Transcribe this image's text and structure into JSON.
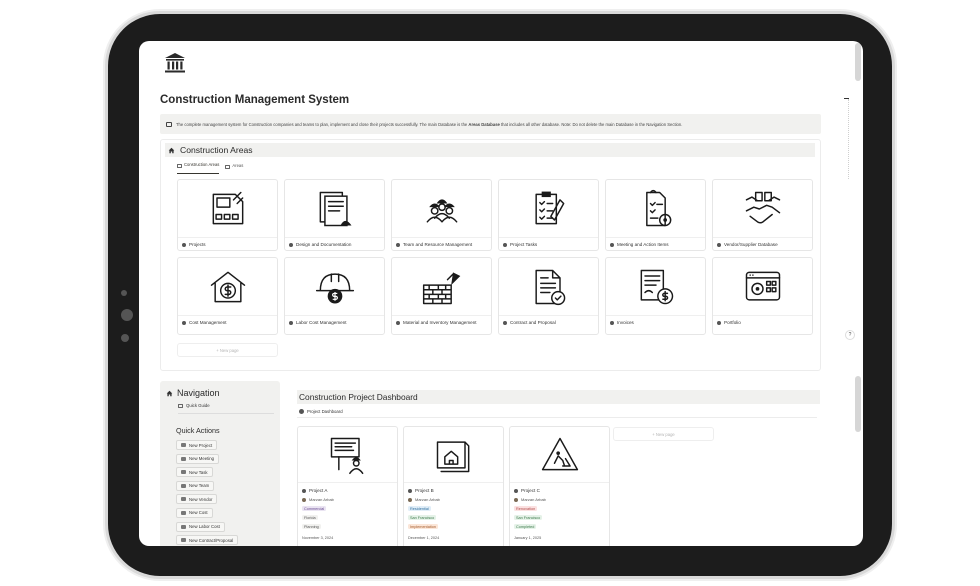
{
  "page": {
    "title": "Construction Management System",
    "callout": {
      "text_before": "The complete management system for Construction companies and teams to plan, implement and close their projects successfully. The main Database is the ",
      "bold": "Areas Database",
      "text_after": " that includes all other database. Note: Do not delete the main Database in the Navigation Section."
    }
  },
  "areas": {
    "title": "Construction Areas",
    "views": [
      "Construction Areas",
      "Areas"
    ],
    "cards": [
      {
        "label": "Projects",
        "icon": "blueprint-icon"
      },
      {
        "label": "Design and Documentation",
        "icon": "documents-icon"
      },
      {
        "label": "Team and Resource Management",
        "icon": "team-icon"
      },
      {
        "label": "Project Tasks",
        "icon": "tasks-clipboard-icon"
      },
      {
        "label": "Meeting and Action Items",
        "icon": "meeting-checklist-icon"
      },
      {
        "label": "Vendor/Supplier Database",
        "icon": "handshake-icon"
      },
      {
        "label": "Cost Management",
        "icon": "house-dollar-icon"
      },
      {
        "label": "Labor Cost Management",
        "icon": "helmet-dollar-icon"
      },
      {
        "label": "Material and Inventory Management",
        "icon": "bricks-trowel-icon"
      },
      {
        "label": "Contract and Proposal",
        "icon": "contract-icon"
      },
      {
        "label": "Invoices",
        "icon": "invoice-icon"
      },
      {
        "label": "Portfolio",
        "icon": "portfolio-browser-icon"
      }
    ],
    "new_page": "+ New page"
  },
  "navigation": {
    "title": "Navigation",
    "quick_guide": "Quick Guide",
    "quick_actions_title": "Quick Actions",
    "actions": [
      "New Project",
      "New Meeting",
      "New Task",
      "New Team",
      "New Vendor",
      "New Cost",
      "New Labor Cost",
      "New Contract/Proposal"
    ]
  },
  "dashboard": {
    "title": "Construction Project Dashboard",
    "view": "Project Dashboard",
    "new_page": "+ New page",
    "projects": [
      {
        "name": "Project A",
        "owner": "Marzan Arbab",
        "tags": [
          {
            "text": "Commercial",
            "bg": "#eae4f2",
            "fg": "#6a4c93"
          },
          {
            "text": "Florida",
            "bg": "#f1f1ef",
            "fg": "#555"
          },
          {
            "text": "Planning",
            "bg": "#f1f1ef",
            "fg": "#555"
          }
        ],
        "date": "November 3, 2024"
      },
      {
        "name": "Project B",
        "owner": "Marzan Arbab",
        "tags": [
          {
            "text": "Residential",
            "bg": "#e1eef8",
            "fg": "#2f6f9f"
          },
          {
            "text": "San Francisco",
            "bg": "#e5f2e8",
            "fg": "#3d7a4b"
          },
          {
            "text": "Implementation",
            "bg": "#fbe6d8",
            "fg": "#a45a2a"
          }
        ],
        "date": "December 1, 2024"
      },
      {
        "name": "Project C",
        "owner": "Marzan Arbab",
        "tags": [
          {
            "text": "Renovation",
            "bg": "#fbe1e1",
            "fg": "#b14a4a"
          },
          {
            "text": "San Francisco",
            "bg": "#e5f2e8",
            "fg": "#3d7a4b"
          },
          {
            "text": "Completed",
            "bg": "#e5f2e8",
            "fg": "#3d7a4b"
          }
        ],
        "date": "January 1, 2025"
      }
    ]
  },
  "help_label": "?"
}
